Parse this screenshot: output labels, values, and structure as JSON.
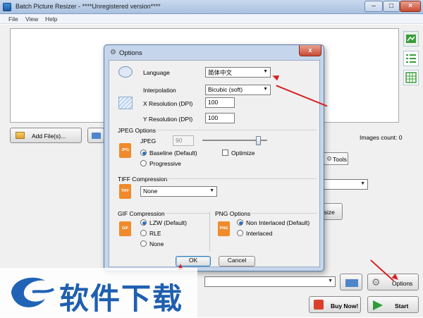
{
  "app": {
    "title": "Batch Picture Resizer - ****Unregistered version****",
    "menu": [
      "File",
      "View",
      "Help"
    ]
  },
  "main": {
    "add_files_label": "Add File(s)...",
    "images_count": "Images count: 0",
    "tools_tab": "Tools",
    "resize_partial": "esize",
    "options_label": "Options",
    "buy_now_label": "Buy Now!",
    "start_label": "Start"
  },
  "dialog": {
    "title": "Options",
    "close_glyph": "x",
    "language_label": "Language",
    "language_value": "简体中文",
    "interpolation_label": "Interpolation",
    "interpolation_value": "Bicubic (soft)",
    "x_res_label": "X Resolution (DPI)",
    "x_res_value": "100",
    "y_res_label": "Y Resolution (DPI)",
    "y_res_value": "100",
    "jpeg_group": "JPEG Options",
    "jpeg_label": "JPEG",
    "jpeg_quality": "90",
    "jpeg_quality_fraction": 0.9,
    "baseline_label": "Baseline (Default)",
    "progressive_label": "Progressive",
    "optimize_label": "Optimize",
    "tiff_group": "TIFF Compression",
    "tiff_value": "None",
    "gif_group": "GIF Compression",
    "lzw_label": "LZW (Default)",
    "rle_label": "RLE",
    "gif_none_label": "None",
    "png_group": "PNG Options",
    "non_interlaced_label": "Non Interlaced (Default)",
    "interlaced_label": "Interlaced",
    "ok_label": "OK",
    "cancel_label": "Cancel",
    "icon_jpg": "JPG",
    "icon_tiff": "TIFF",
    "icon_gif": "GIF",
    "icon_png": "PNG"
  },
  "watermark": {
    "text": "软件下载"
  },
  "colors": {
    "accent": "#2d6fc9",
    "arrow": "#d62222",
    "file_icon": "#f08a2c"
  }
}
